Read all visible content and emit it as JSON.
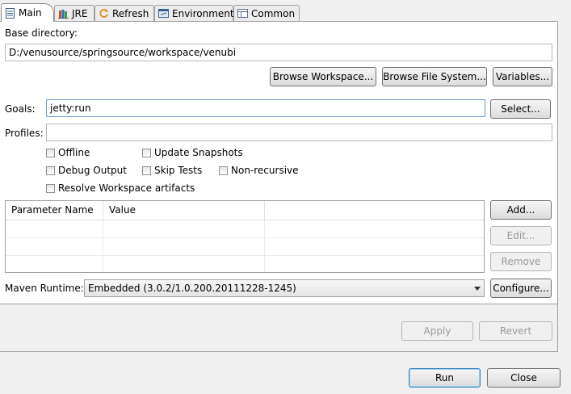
{
  "tabs": [
    {
      "label": "Main",
      "icon": "document-icon"
    },
    {
      "label": "JRE",
      "icon": "books-icon"
    },
    {
      "label": "Refresh",
      "icon": "refresh-icon"
    },
    {
      "label": "Environment",
      "icon": "environment-icon"
    },
    {
      "label": "Common",
      "icon": "common-icon"
    }
  ],
  "base_directory": {
    "label": "Base directory:",
    "value": "D:/venusource/springsource/workspace/venubi"
  },
  "browse": {
    "workspace": "Browse Workspace...",
    "file_system": "Browse File System...",
    "variables": "Variables..."
  },
  "goals": {
    "label": "Goals:",
    "value": "jetty:run",
    "select": "Select..."
  },
  "profiles": {
    "label": "Profiles:",
    "value": ""
  },
  "options": {
    "offline": "Offline",
    "update_snapshots": "Update Snapshots",
    "debug_output": "Debug Output",
    "skip_tests": "Skip Tests",
    "non_recursive": "Non-recursive",
    "resolve_workspace": "Resolve Workspace artifacts"
  },
  "params_table": {
    "columns": [
      "Parameter Name",
      "Value"
    ],
    "rows": []
  },
  "param_buttons": {
    "add": "Add...",
    "edit": "Edit...",
    "remove": "Remove"
  },
  "maven_runtime": {
    "label": "Maven Runtime:",
    "value": "Embedded (3.0.2/1.0.200.20111228-1245)",
    "configure": "Configure..."
  },
  "apply_revert": {
    "apply": "Apply",
    "revert": "Revert"
  },
  "dialog_buttons": {
    "run": "Run",
    "close": "Close"
  },
  "colors": {
    "focus_border": "#6d9bd1",
    "default_button_border": "#3c7fb1"
  }
}
